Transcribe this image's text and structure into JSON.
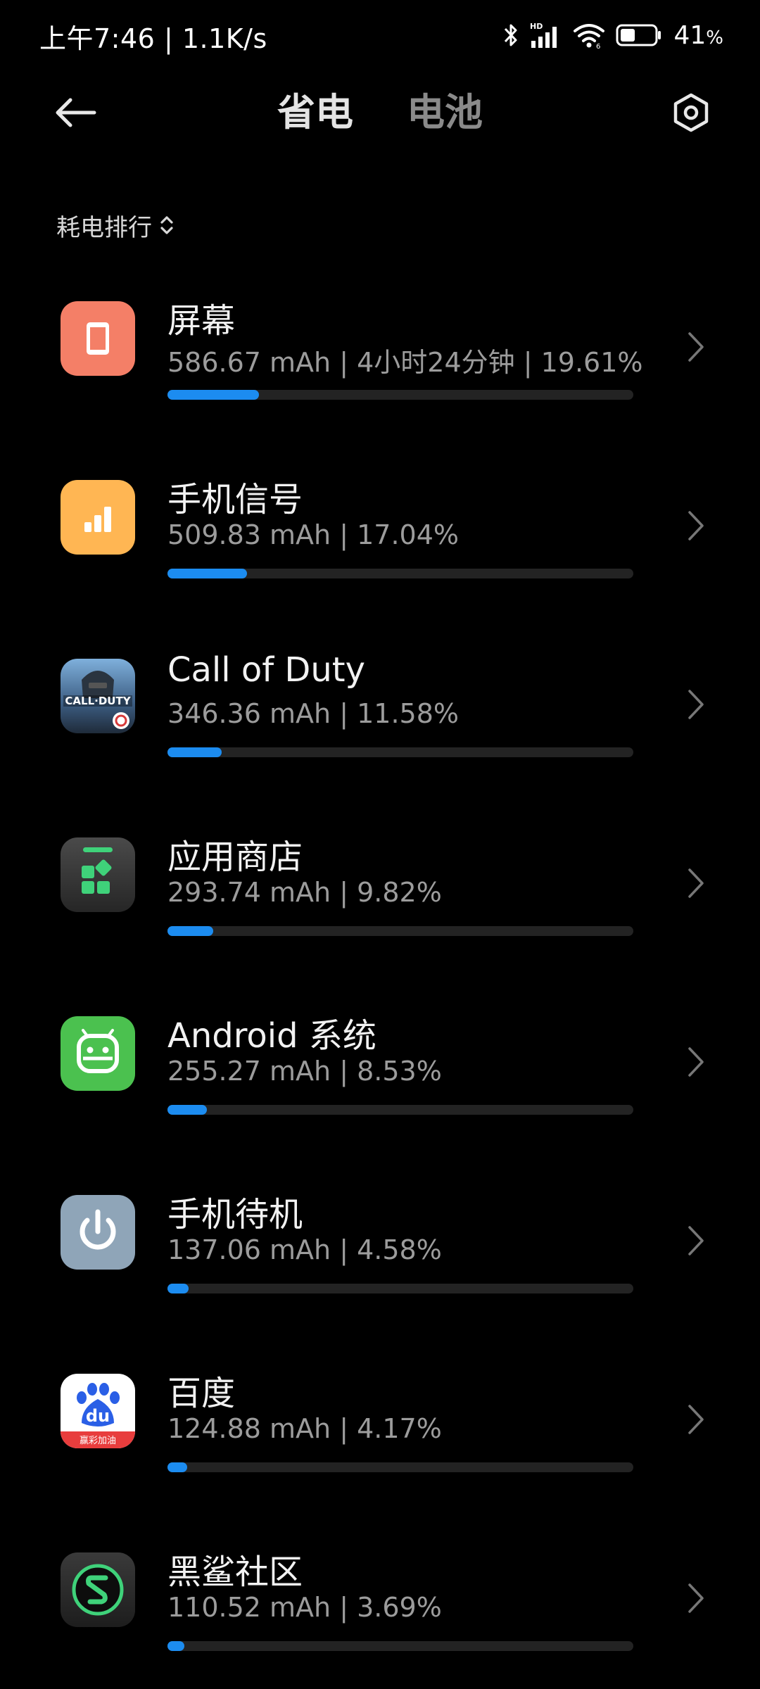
{
  "status_bar": {
    "time": "上午7:46",
    "network_speed": "1.1K/s",
    "battery_level": "41",
    "battery_unit": "%",
    "icons": [
      "bluetooth-icon",
      "hd-signal-icon",
      "wifi-icon",
      "battery-icon"
    ]
  },
  "header": {
    "tabs": [
      {
        "label": "省电",
        "active": true
      },
      {
        "label": "电池",
        "active": false
      }
    ],
    "back_icon": "arrow-left-icon",
    "settings_icon": "settings-hexagon-icon"
  },
  "sort": {
    "label": "耗电排行",
    "icon": "sort-updown-icon"
  },
  "usage_items": [
    {
      "name": "屏幕",
      "stats": "586.67 mAh | 4小时24分钟 | 19.61%",
      "percent": 19.61,
      "icon": "screen-icon",
      "icon_bg": "#f47f67"
    },
    {
      "name": "手机信号",
      "stats": "509.83 mAh | 17.04%",
      "percent": 17.04,
      "icon": "signal-icon",
      "icon_bg": "#ffb653"
    },
    {
      "name": "Call of Duty",
      "stats": "346.36 mAh | 11.58%",
      "percent": 11.58,
      "icon": "call-of-duty-icon",
      "icon_bg": "#5f8fbf",
      "icon_text": "CALL·DUTY"
    },
    {
      "name": "应用商店",
      "stats": "293.74 mAh | 9.82%",
      "percent": 9.82,
      "icon": "app-store-icon",
      "icon_bg": "#3a3a3a"
    },
    {
      "name": "Android 系统",
      "stats": "255.27 mAh | 8.53%",
      "percent": 8.53,
      "icon": "android-icon",
      "icon_bg": "#4bc14f"
    },
    {
      "name": "手机待机",
      "stats": "137.06 mAh | 4.58%",
      "percent": 4.58,
      "icon": "power-icon",
      "icon_bg": "#8fa5b8"
    },
    {
      "name": "百度",
      "stats": "124.88 mAh | 4.17%",
      "percent": 4.17,
      "icon": "baidu-icon",
      "icon_bg": "#ffffff",
      "icon_text": "du",
      "icon_subtext": "赢彩加油"
    },
    {
      "name": "黑鲨社区",
      "stats": "110.52 mAh | 3.69%",
      "percent": 3.69,
      "icon": "black-shark-icon",
      "icon_bg": "#2a2a2a"
    }
  ],
  "bar_scale_max_percent": 100,
  "colors": {
    "background": "#000000",
    "accent": "#1c8cf0",
    "track": "#232323"
  }
}
